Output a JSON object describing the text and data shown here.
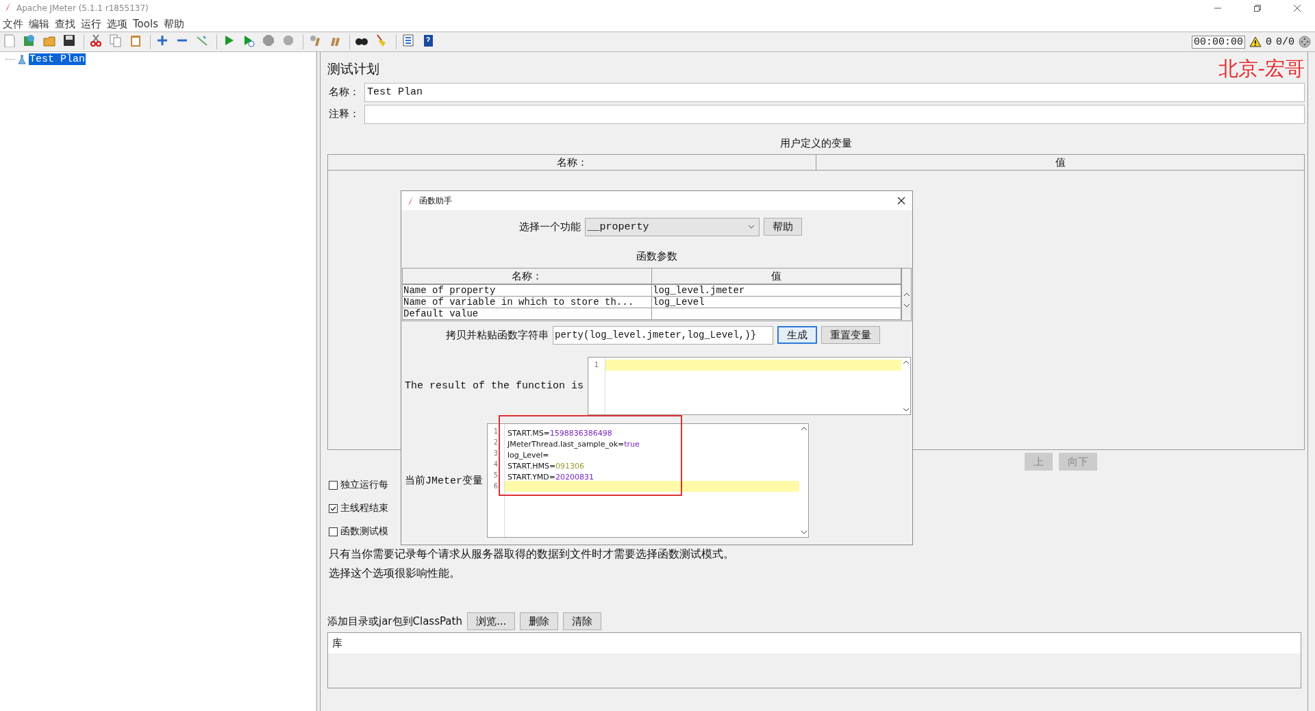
{
  "window": {
    "title": "Apache JMeter (5.1.1 r1855137)"
  },
  "menu": [
    "文件",
    "编辑",
    "查找",
    "运行",
    "选项",
    "Tools",
    "帮助"
  ],
  "status": {
    "timer": "00:00:00",
    "warnings": "0",
    "threads": "0/0"
  },
  "tree": [
    {
      "label": "Test Plan",
      "selected": true
    }
  ],
  "author_label": "北京-宏哥",
  "test_plan": {
    "title": "测试计划",
    "name_label": "名称：",
    "name_value": "Test Plan",
    "comment_label": "注释：",
    "variables_title": "用户定义的变量",
    "variables_columns": [
      "名称：",
      "值"
    ],
    "table_buttons": [
      {
        "label": "上",
        "disabled": true
      },
      {
        "label": "向下",
        "disabled": true
      }
    ],
    "options": [
      {
        "label": "独立运行每",
        "checked": false
      },
      {
        "label": "主线程结束",
        "checked": true
      },
      {
        "label": "函数测试模",
        "checked": false
      }
    ],
    "note_lines": [
      "只有当你需要记录每个请求从服务器取得的数据到文件时才需要选择函数测试模式。",
      "选择这个选项很影响性能。"
    ],
    "classpath_label": "添加目录或jar包到ClassPath",
    "classpath_buttons": [
      "浏览...",
      "删除",
      "清除"
    ],
    "library_columns": [
      "库"
    ]
  },
  "dialog": {
    "title": "函数助手",
    "function_label": "选择一个功能",
    "function_value": "__property",
    "help_button": "帮助",
    "params_title": "函数参数",
    "params_columns": [
      "名称：",
      "值"
    ],
    "params_rows": [
      {
        "name": "Name of property",
        "value": "log_level.jmeter"
      },
      {
        "name": "Name of variable in which to store th...",
        "value": "log_Level"
      },
      {
        "name": "Default value"
      }
    ],
    "copy_label": "拷贝并粘贴函数字符串",
    "function_string": "perty(log_level.jmeter,log_Level,)}",
    "buttons": [
      {
        "label": "生成",
        "focused": true
      },
      {
        "label": "重置变量",
        "focused": false
      }
    ],
    "result_label": "The result of the function is",
    "result_lines": [
      {
        "line": "1",
        "current": true
      }
    ],
    "variables_label": "当前JMeter变量",
    "variables": [
      {
        "line": "1",
        "name": "START.MS=",
        "value": "1598836386498",
        "color": "#7b22c4",
        "current": false
      },
      {
        "line": "2",
        "name": "JMeterThread.last_sample_ok=",
        "value": "true",
        "color": "#7b22c4",
        "current": false
      },
      {
        "line": "3",
        "name": "log_Level=",
        "current": false
      },
      {
        "line": "4",
        "name": "START.HMS=",
        "value": "091306",
        "color": "#9a9a2c",
        "current": false
      },
      {
        "line": "5",
        "name": "START.YMD=",
        "value": "20200831",
        "color": "#7b22c4",
        "current": false
      },
      {
        "line": "6",
        "current": true
      }
    ],
    "highlight_box": true
  }
}
